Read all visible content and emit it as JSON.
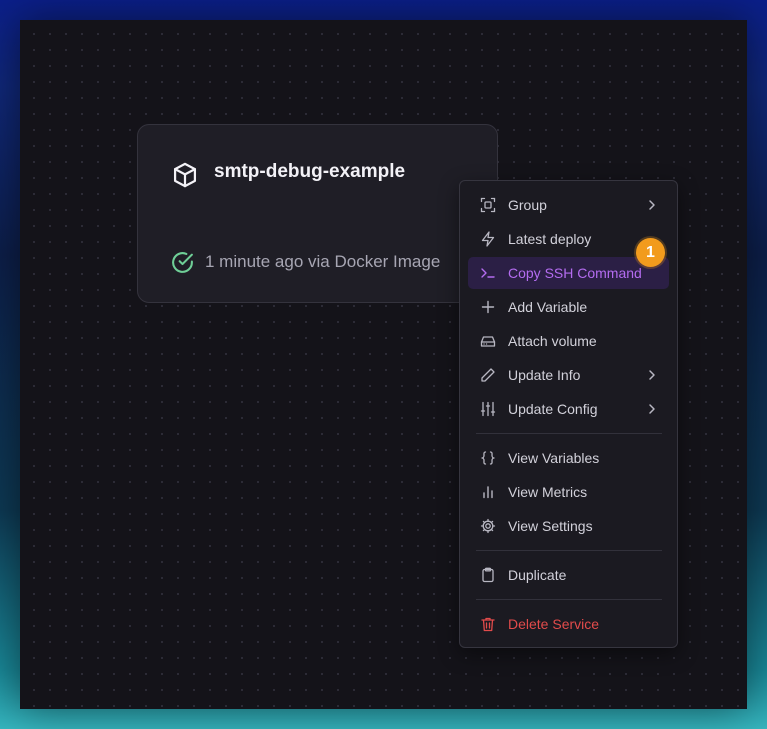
{
  "service_card": {
    "name": "smtp-debug-example",
    "status_text": "1 minute ago via Docker Image"
  },
  "context_menu": {
    "items": [
      {
        "label": "Group",
        "icon": "group-icon"
      },
      {
        "label": "Latest deploy",
        "icon": "lightning-icon"
      },
      {
        "label": "Copy SSH Command",
        "icon": "terminal-icon"
      },
      {
        "label": "Add Variable",
        "icon": "plus-icon"
      },
      {
        "label": "Attach volume",
        "icon": "hard-drive-icon"
      },
      {
        "label": "Update Info",
        "icon": "pencil-icon"
      },
      {
        "label": "Update Config",
        "icon": "sliders-icon"
      },
      {
        "label": "View Variables",
        "icon": "braces-icon"
      },
      {
        "label": "View Metrics",
        "icon": "bar-chart-icon"
      },
      {
        "label": "View Settings",
        "icon": "gear-icon"
      },
      {
        "label": "Duplicate",
        "icon": "clipboard-icon"
      },
      {
        "label": "Delete Service",
        "icon": "trash-icon"
      }
    ]
  },
  "step_badge": "1",
  "colors": {
    "accent": "#b46cf0",
    "danger": "#e24b4b",
    "badge": "#f29b1d",
    "success": "#6fcf97"
  }
}
